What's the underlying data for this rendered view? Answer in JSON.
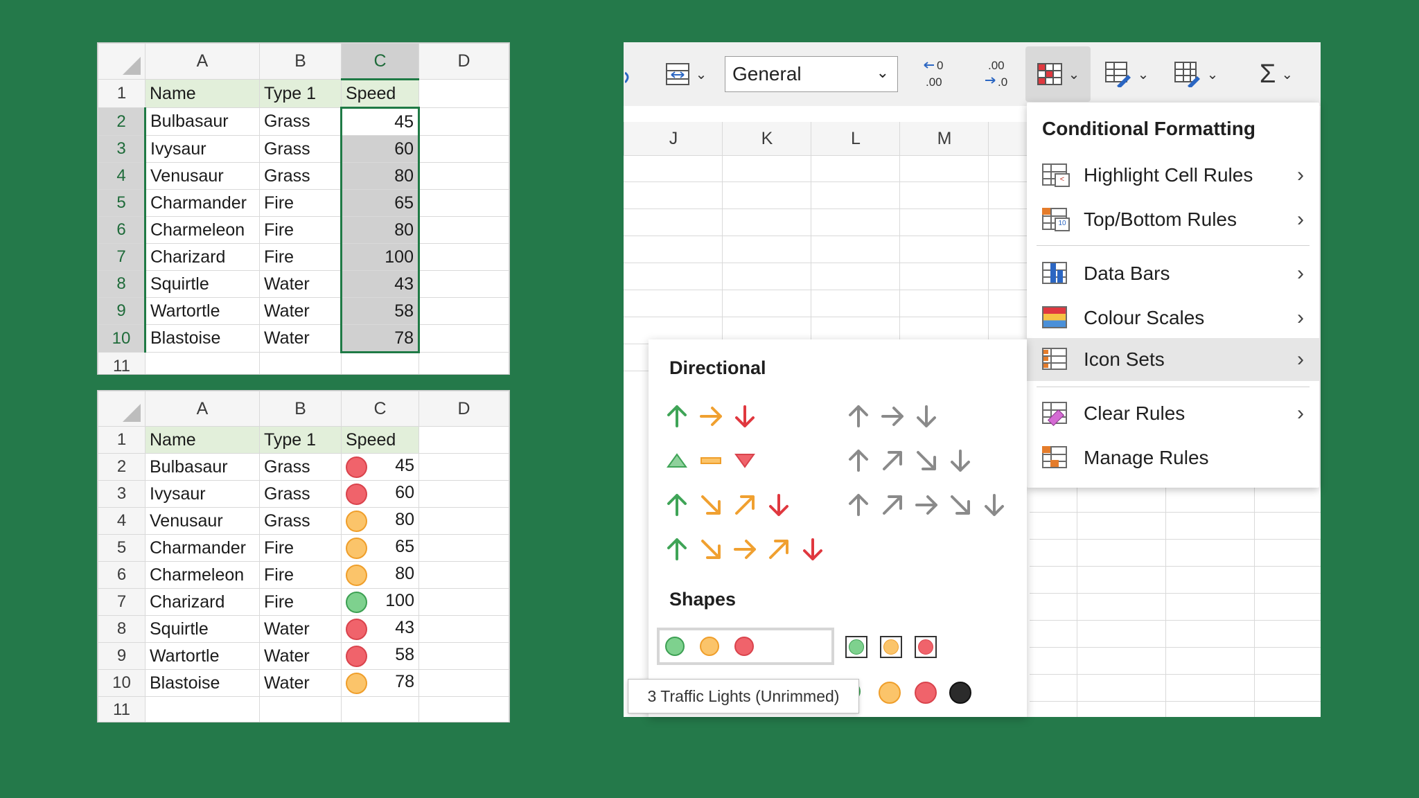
{
  "sheet_top": {
    "columns": [
      "A",
      "B",
      "C",
      "D"
    ],
    "selected_column": "C",
    "rows": [
      {
        "n": "1",
        "name": "Name",
        "type": "Type 1",
        "speed": "Speed"
      },
      {
        "n": "2",
        "name": "Bulbasaur",
        "type": "Grass",
        "speed": "45"
      },
      {
        "n": "3",
        "name": "Ivysaur",
        "type": "Grass",
        "speed": "60"
      },
      {
        "n": "4",
        "name": "Venusaur",
        "type": "Grass",
        "speed": "80"
      },
      {
        "n": "5",
        "name": "Charmander",
        "type": "Fire",
        "speed": "65"
      },
      {
        "n": "6",
        "name": "Charmeleon",
        "type": "Fire",
        "speed": "80"
      },
      {
        "n": "7",
        "name": "Charizard",
        "type": "Fire",
        "speed": "100"
      },
      {
        "n": "8",
        "name": "Squirtle",
        "type": "Water",
        "speed": "43"
      },
      {
        "n": "9",
        "name": "Wartortle",
        "type": "Water",
        "speed": "58"
      },
      {
        "n": "10",
        "name": "Blastoise",
        "type": "Water",
        "speed": "78"
      },
      {
        "n": "11",
        "name": "",
        "type": "",
        "speed": ""
      }
    ]
  },
  "sheet_bottom": {
    "columns": [
      "A",
      "B",
      "C",
      "D"
    ],
    "rows": [
      {
        "n": "1",
        "name": "Name",
        "type": "Type 1",
        "speed": "Speed",
        "icon": ""
      },
      {
        "n": "2",
        "name": "Bulbasaur",
        "type": "Grass",
        "speed": "45",
        "icon": "red"
      },
      {
        "n": "3",
        "name": "Ivysaur",
        "type": "Grass",
        "speed": "60",
        "icon": "red"
      },
      {
        "n": "4",
        "name": "Venusaur",
        "type": "Grass",
        "speed": "80",
        "icon": "yellow"
      },
      {
        "n": "5",
        "name": "Charmander",
        "type": "Fire",
        "speed": "65",
        "icon": "yellow"
      },
      {
        "n": "6",
        "name": "Charmeleon",
        "type": "Fire",
        "speed": "80",
        "icon": "yellow"
      },
      {
        "n": "7",
        "name": "Charizard",
        "type": "Fire",
        "speed": "100",
        "icon": "green"
      },
      {
        "n": "8",
        "name": "Squirtle",
        "type": "Water",
        "speed": "43",
        "icon": "red"
      },
      {
        "n": "9",
        "name": "Wartortle",
        "type": "Water",
        "speed": "58",
        "icon": "red"
      },
      {
        "n": "10",
        "name": "Blastoise",
        "type": "Water",
        "speed": "78",
        "icon": "yellow"
      },
      {
        "n": "11",
        "name": "",
        "type": "",
        "speed": "",
        "icon": ""
      }
    ]
  },
  "ribbon": {
    "number_format": "General",
    "increase_decimal_icon": "increase-decimal-icon",
    "decrease_decimal_icon": "decrease-decimal-icon"
  },
  "grid_right": {
    "columns": [
      "J",
      "K",
      "L",
      "M"
    ]
  },
  "cf_menu": {
    "title": "Conditional Formatting",
    "items": [
      {
        "label": "Highlight Cell Rules",
        "icon": "highlight-cell-rules-icon",
        "submenu": true
      },
      {
        "label": "Top/Bottom Rules",
        "icon": "top-bottom-rules-icon",
        "submenu": true
      },
      {
        "label": "Data Bars",
        "icon": "data-bars-icon",
        "submenu": true
      },
      {
        "label": "Colour Scales",
        "icon": "colour-scales-icon",
        "submenu": true
      },
      {
        "label": "Icon Sets",
        "icon": "icon-sets-icon",
        "submenu": true,
        "highlighted": true
      },
      {
        "label": "Clear Rules",
        "icon": "clear-rules-icon",
        "submenu": true
      },
      {
        "label": "Manage Rules",
        "icon": "manage-rules-icon",
        "submenu": false
      }
    ]
  },
  "icon_sets": {
    "directional_heading": "Directional",
    "shapes_heading": "Shapes",
    "tooltip": "3 Traffic Lights (Unrimmed)"
  },
  "colors": {
    "background": "#24794a",
    "selection": "#1f7a45",
    "header_fill": "#e2efda",
    "green": "#3fa457",
    "orange": "#f0a030",
    "red": "#e0383f",
    "gray_arrow": "#8a8a8a"
  }
}
